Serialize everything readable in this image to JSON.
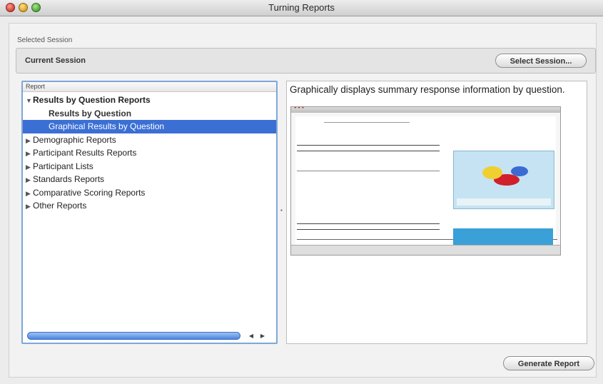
{
  "window": {
    "title": "Turning Reports"
  },
  "session": {
    "group_label": "Selected Session",
    "current": "Current Session",
    "select_button": "Select Session..."
  },
  "report": {
    "header": "Report",
    "items": [
      {
        "label": "Results by Question Reports",
        "expanded": true
      },
      {
        "label": "Results by Question"
      },
      {
        "label": "Graphical Results by Question",
        "selected": true
      },
      {
        "label": "Demographic Reports"
      },
      {
        "label": "Participant Results Reports"
      },
      {
        "label": "Participant Lists"
      },
      {
        "label": "Standards Reports"
      },
      {
        "label": "Comparative Scoring Reports"
      },
      {
        "label": "Other Reports"
      }
    ]
  },
  "description": "Graphically displays summary response information by question.",
  "generate_button": "Generate Report",
  "colors": {
    "selection": "#3b6fd4",
    "accent": "#7ea6d8"
  }
}
